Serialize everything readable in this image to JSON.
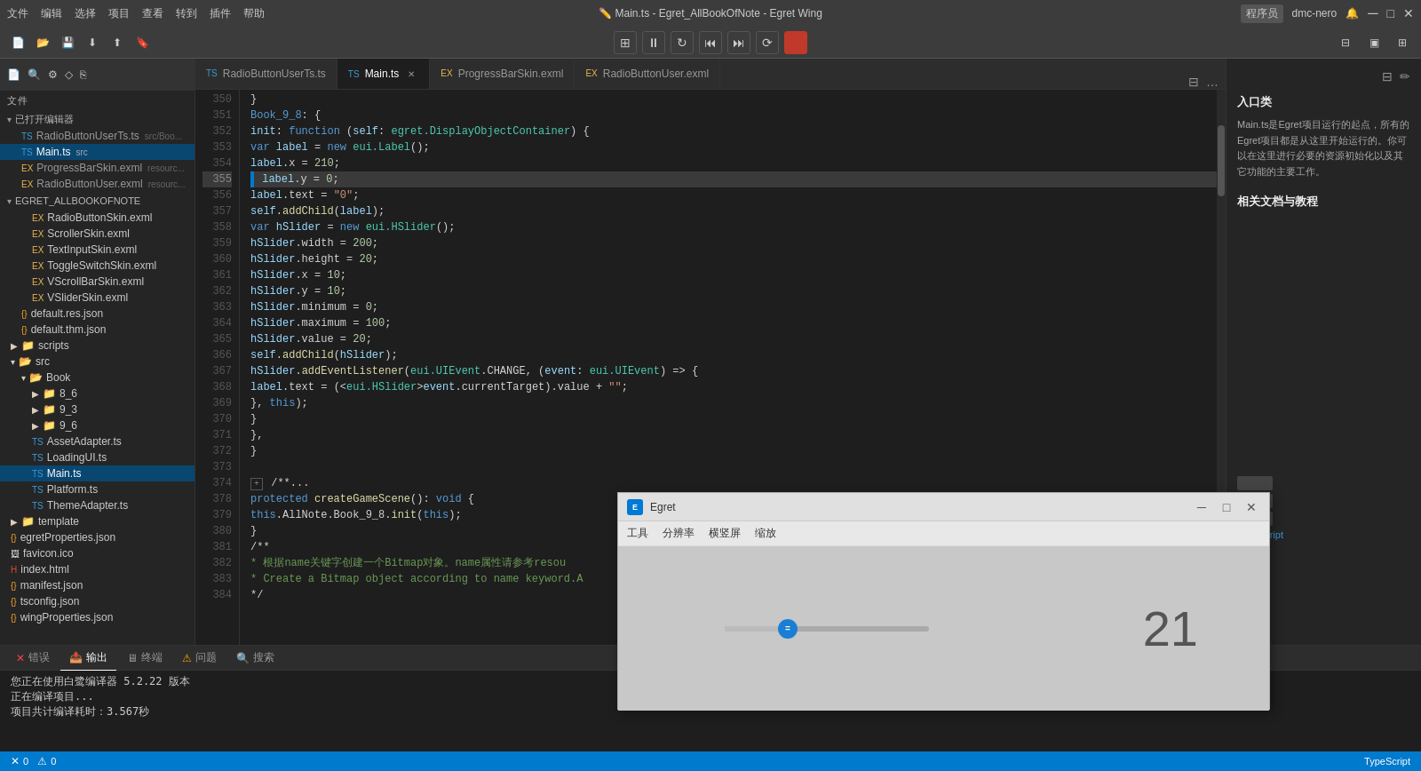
{
  "titlebar": {
    "menus": [
      "文件",
      "编辑",
      "选择",
      "项目",
      "查看",
      "转到",
      "插件",
      "帮助"
    ],
    "title": "Main.ts - Egret_AllBookOfNote - Egret Wing",
    "user": "程序员",
    "username": "dmc-nero"
  },
  "toolbar": {
    "buttons": [
      "new-file",
      "open",
      "save-all",
      "download",
      "upload",
      "bookmark"
    ]
  },
  "run_toolbar": {
    "buttons": [
      "grid",
      "pause",
      "refresh",
      "prev",
      "next",
      "reload",
      "stop"
    ]
  },
  "tabs": [
    {
      "label": "RadioButtonUserTs.ts",
      "icon": "ts",
      "active": false,
      "closable": false
    },
    {
      "label": "Main.ts",
      "icon": "ts",
      "active": true,
      "closable": true
    },
    {
      "label": "ProgressBarSkin.exml",
      "icon": "exml",
      "active": false,
      "closable": false
    },
    {
      "label": "RadioButtonUser.exml",
      "icon": "exml",
      "active": false,
      "closable": false
    }
  ],
  "sidebar": {
    "section_open_files": "已打开编辑器",
    "open_files": [
      {
        "label": "RadioButtonUserTs.ts",
        "sub": "src/Boo...",
        "icon": "ts"
      },
      {
        "label": "Main.ts",
        "sub": "src",
        "icon": "ts",
        "active": true
      },
      {
        "label": "ProgressBarSkin.exml",
        "sub": "resourc...",
        "icon": "exml"
      },
      {
        "label": "RadioButtonUser.exml",
        "sub": "resourc...",
        "icon": "exml"
      }
    ],
    "section_project": "EGRET_ALLBOOKOFNOTE",
    "tree": [
      {
        "label": "RadioButtonSkin.exml",
        "indent": 2,
        "icon": "exml"
      },
      {
        "label": "ScrollerSkin.exml",
        "indent": 2,
        "icon": "exml"
      },
      {
        "label": "TextInputSkin.exml",
        "indent": 2,
        "icon": "exml"
      },
      {
        "label": "ToggleSwitchSkin.exml",
        "indent": 2,
        "icon": "exml"
      },
      {
        "label": "VScrollBarSkin.exml",
        "indent": 2,
        "icon": "exml"
      },
      {
        "label": "VSliderSkin.exml",
        "indent": 2,
        "icon": "exml"
      },
      {
        "label": "default.res.json",
        "indent": 1,
        "icon": "json"
      },
      {
        "label": "default.thm.json",
        "indent": 1,
        "icon": "json"
      },
      {
        "label": "scripts",
        "indent": 0,
        "icon": "folder"
      },
      {
        "label": "src",
        "indent": 0,
        "icon": "folder-open"
      },
      {
        "label": "Book",
        "indent": 1,
        "icon": "folder-open"
      },
      {
        "label": "8_6",
        "indent": 2,
        "icon": "folder"
      },
      {
        "label": "9_3",
        "indent": 2,
        "icon": "folder"
      },
      {
        "label": "9_6",
        "indent": 2,
        "icon": "folder"
      },
      {
        "label": "AssetAdapter.ts",
        "indent": 2,
        "icon": "ts"
      },
      {
        "label": "LoadingUI.ts",
        "indent": 2,
        "icon": "ts"
      },
      {
        "label": "Main.ts",
        "indent": 2,
        "icon": "ts",
        "active": true
      },
      {
        "label": "Platform.ts",
        "indent": 2,
        "icon": "ts"
      },
      {
        "label": "ThemeAdapter.ts",
        "indent": 2,
        "icon": "ts"
      },
      {
        "label": "template",
        "indent": 0,
        "icon": "folder"
      },
      {
        "label": "egretProperties.json",
        "indent": 0,
        "icon": "json"
      },
      {
        "label": "favicon.ico",
        "indent": 0,
        "icon": "ico"
      },
      {
        "label": "index.html",
        "indent": 0,
        "icon": "html"
      },
      {
        "label": "manifest.json",
        "indent": 0,
        "icon": "json"
      },
      {
        "label": "tsconfig.json",
        "indent": 0,
        "icon": "json"
      },
      {
        "label": "wingProperties.json",
        "indent": 0,
        "icon": "json"
      }
    ]
  },
  "code": {
    "lines": [
      {
        "num": "350",
        "tokens": [
          {
            "t": "plain",
            "v": "    }"
          }
        ]
      },
      {
        "num": "351",
        "tokens": [
          {
            "t": "plain",
            "v": "    "
          },
          {
            "t": "kw",
            "v": "Book_9_8"
          },
          {
            "t": "plain",
            "v": ": {"
          }
        ]
      },
      {
        "num": "352",
        "tokens": [
          {
            "t": "plain",
            "v": "        "
          },
          {
            "t": "var",
            "v": "init"
          },
          {
            "t": "plain",
            "v": ": "
          },
          {
            "t": "kw",
            "v": "function"
          },
          {
            "t": "plain",
            "v": " ("
          },
          {
            "t": "var",
            "v": "self"
          },
          {
            "t": "plain",
            "v": ": "
          },
          {
            "t": "type",
            "v": "egret.DisplayObjectContainer"
          },
          {
            "t": "plain",
            "v": ") {"
          }
        ]
      },
      {
        "num": "353",
        "tokens": [
          {
            "t": "plain",
            "v": "            "
          },
          {
            "t": "kw",
            "v": "var"
          },
          {
            "t": "plain",
            "v": " "
          },
          {
            "t": "var",
            "v": "label"
          },
          {
            "t": "plain",
            "v": " = "
          },
          {
            "t": "kw",
            "v": "new"
          },
          {
            "t": "plain",
            "v": " "
          },
          {
            "t": "type",
            "v": "eui.Label"
          },
          {
            "t": "plain",
            "v": "();"
          }
        ]
      },
      {
        "num": "354",
        "tokens": [
          {
            "t": "plain",
            "v": "            "
          },
          {
            "t": "var",
            "v": "label"
          },
          {
            "t": "plain",
            "v": ".x = "
          },
          {
            "t": "num",
            "v": "210"
          },
          {
            "t": "plain",
            "v": ";"
          }
        ]
      },
      {
        "num": "355",
        "tokens": [
          {
            "t": "plain",
            "v": "            "
          },
          {
            "t": "var",
            "v": "label"
          },
          {
            "t": "plain",
            "v": ".y = "
          },
          {
            "t": "num",
            "v": "0"
          },
          {
            "t": "plain",
            "v": ";"
          }
        ],
        "highlighted": true
      },
      {
        "num": "356",
        "tokens": [
          {
            "t": "plain",
            "v": "            "
          },
          {
            "t": "var",
            "v": "label"
          },
          {
            "t": "plain",
            "v": ".text = "
          },
          {
            "t": "str",
            "v": "\"0\""
          },
          {
            "t": "plain",
            "v": ";"
          }
        ]
      },
      {
        "num": "357",
        "tokens": [
          {
            "t": "plain",
            "v": "            "
          },
          {
            "t": "var",
            "v": "self"
          },
          {
            "t": "plain",
            "v": "."
          },
          {
            "t": "fn",
            "v": "addChild"
          },
          {
            "t": "plain",
            "v": "("
          },
          {
            "t": "var",
            "v": "label"
          },
          {
            "t": "plain",
            "v": ");"
          }
        ]
      },
      {
        "num": "358",
        "tokens": [
          {
            "t": "plain",
            "v": "            "
          },
          {
            "t": "kw",
            "v": "var"
          },
          {
            "t": "plain",
            "v": " "
          },
          {
            "t": "var",
            "v": "hSlider"
          },
          {
            "t": "plain",
            "v": " = "
          },
          {
            "t": "kw",
            "v": "new"
          },
          {
            "t": "plain",
            "v": " "
          },
          {
            "t": "type",
            "v": "eui.HSlider"
          },
          {
            "t": "plain",
            "v": "();"
          }
        ]
      },
      {
        "num": "359",
        "tokens": [
          {
            "t": "plain",
            "v": "            "
          },
          {
            "t": "var",
            "v": "hSlider"
          },
          {
            "t": "plain",
            "v": ".width = "
          },
          {
            "t": "num",
            "v": "200"
          },
          {
            "t": "plain",
            "v": ";"
          }
        ]
      },
      {
        "num": "360",
        "tokens": [
          {
            "t": "plain",
            "v": "            "
          },
          {
            "t": "var",
            "v": "hSlider"
          },
          {
            "t": "plain",
            "v": ".height = "
          },
          {
            "t": "num",
            "v": "20"
          },
          {
            "t": "plain",
            "v": ";"
          }
        ]
      },
      {
        "num": "361",
        "tokens": [
          {
            "t": "plain",
            "v": "            "
          },
          {
            "t": "var",
            "v": "hSlider"
          },
          {
            "t": "plain",
            "v": ".x = "
          },
          {
            "t": "num",
            "v": "10"
          },
          {
            "t": "plain",
            "v": ";"
          }
        ]
      },
      {
        "num": "362",
        "tokens": [
          {
            "t": "plain",
            "v": "            "
          },
          {
            "t": "var",
            "v": "hSlider"
          },
          {
            "t": "plain",
            "v": ".y = "
          },
          {
            "t": "num",
            "v": "10"
          },
          {
            "t": "plain",
            "v": ";"
          }
        ]
      },
      {
        "num": "363",
        "tokens": [
          {
            "t": "plain",
            "v": "            "
          },
          {
            "t": "var",
            "v": "hSlider"
          },
          {
            "t": "plain",
            "v": ".minimum = "
          },
          {
            "t": "num",
            "v": "0"
          },
          {
            "t": "plain",
            "v": ";"
          }
        ]
      },
      {
        "num": "364",
        "tokens": [
          {
            "t": "plain",
            "v": "            "
          },
          {
            "t": "var",
            "v": "hSlider"
          },
          {
            "t": "plain",
            "v": ".maximum = "
          },
          {
            "t": "num",
            "v": "100"
          },
          {
            "t": "plain",
            "v": ";"
          }
        ]
      },
      {
        "num": "365",
        "tokens": [
          {
            "t": "plain",
            "v": "            "
          },
          {
            "t": "var",
            "v": "hSlider"
          },
          {
            "t": "plain",
            "v": ".value = "
          },
          {
            "t": "num",
            "v": "20"
          },
          {
            "t": "plain",
            "v": ";"
          }
        ]
      },
      {
        "num": "366",
        "tokens": [
          {
            "t": "plain",
            "v": "            "
          },
          {
            "t": "var",
            "v": "self"
          },
          {
            "t": "plain",
            "v": "."
          },
          {
            "t": "fn",
            "v": "addChild"
          },
          {
            "t": "plain",
            "v": "("
          },
          {
            "t": "var",
            "v": "hSlider"
          },
          {
            "t": "plain",
            "v": ");"
          }
        ]
      },
      {
        "num": "367",
        "tokens": [
          {
            "t": "plain",
            "v": "            "
          },
          {
            "t": "var",
            "v": "hSlider"
          },
          {
            "t": "plain",
            "v": "."
          },
          {
            "t": "fn",
            "v": "addEventListener"
          },
          {
            "t": "plain",
            "v": "("
          },
          {
            "t": "type",
            "v": "eui.UIEvent"
          },
          {
            "t": "plain",
            "v": ".CHANGE, ("
          },
          {
            "t": "var",
            "v": "event"
          },
          {
            "t": "plain",
            "v": ": "
          },
          {
            "t": "type",
            "v": "eui.UIEvent"
          },
          {
            "t": "plain",
            "v": ") => {"
          }
        ]
      },
      {
        "num": "368",
        "tokens": [
          {
            "t": "plain",
            "v": "                "
          },
          {
            "t": "var",
            "v": "label"
          },
          {
            "t": "plain",
            "v": ".text = (<"
          },
          {
            "t": "type",
            "v": "eui.HSlider"
          },
          {
            "t": "plain",
            "v": ">"
          },
          {
            "t": "var",
            "v": "event"
          },
          {
            "t": "plain",
            "v": ".currentTarget).value + "
          },
          {
            "t": "str",
            "v": "\"\""
          },
          {
            "t": "plain",
            "v": ";"
          }
        ]
      },
      {
        "num": "369",
        "tokens": [
          {
            "t": "plain",
            "v": "            }, "
          },
          {
            "t": "kw",
            "v": "this"
          },
          {
            "t": "plain",
            "v": ");"
          }
        ]
      },
      {
        "num": "370",
        "tokens": [
          {
            "t": "plain",
            "v": "        }"
          }
        ]
      },
      {
        "num": "371",
        "tokens": [
          {
            "t": "plain",
            "v": "    },"
          }
        ]
      },
      {
        "num": "372",
        "tokens": [
          {
            "t": "plain",
            "v": "    }"
          }
        ]
      },
      {
        "num": "373",
        "tokens": [
          {
            "t": "plain",
            "v": ""
          }
        ]
      },
      {
        "num": "374",
        "tokens": [
          {
            "t": "plain",
            "v": "    /**..."
          }
        ]
      },
      {
        "num": "378",
        "tokens": [
          {
            "t": "plain",
            "v": "    "
          },
          {
            "t": "kw",
            "v": "protected"
          },
          {
            "t": "plain",
            "v": " "
          },
          {
            "t": "fn",
            "v": "createGameScene"
          },
          {
            "t": "plain",
            "v": "(): "
          },
          {
            "t": "kw",
            "v": "void"
          },
          {
            "t": "plain",
            "v": " {"
          }
        ]
      },
      {
        "num": "379",
        "tokens": [
          {
            "t": "plain",
            "v": "        "
          },
          {
            "t": "kw",
            "v": "this"
          },
          {
            "t": "plain",
            "v": ".AllNote.Book_9_8."
          },
          {
            "t": "fn",
            "v": "init"
          },
          {
            "t": "plain",
            "v": "("
          },
          {
            "t": "kw",
            "v": "this"
          },
          {
            "t": "plain",
            "v": ");"
          }
        ]
      },
      {
        "num": "380",
        "tokens": [
          {
            "t": "plain",
            "v": "    }"
          }
        ]
      },
      {
        "num": "381",
        "tokens": [
          {
            "t": "plain",
            "v": "    /**"
          }
        ]
      },
      {
        "num": "382",
        "tokens": [
          {
            "t": "cmt",
            "v": "     * 根据name关键字创建一个Bitmap对象。name属性请参考resou"
          }
        ]
      },
      {
        "num": "383",
        "tokens": [
          {
            "t": "cmt",
            "v": "     * Create a Bitmap object according to name keyword.A"
          }
        ]
      },
      {
        "num": "384",
        "tokens": [
          {
            "t": "plain",
            "v": "     */"
          }
        ]
      }
    ]
  },
  "right_panel": {
    "title": "入口类",
    "description": "Main.ts是Egret项目运行的起点，所有的Egret项目都是从这里开始运行的。你可以在这里进行必要的资源初始化以及其它功能的主要工作。",
    "subtitle": "相关文档与教程"
  },
  "bottom_panel": {
    "tabs": [
      "错误",
      "输出",
      "终端",
      "问题",
      "搜索"
    ],
    "active_tab": "输出",
    "messages": [
      "您正在使用白鹭编译器 5.2.22 版本",
      "正在编译项目...",
      "项目共计编译耗时：3.567秒"
    ]
  },
  "statusbar": {
    "errors": "0",
    "warnings": "0",
    "language": "TypeScript"
  },
  "egret_popup": {
    "title": "Egret",
    "menus": [
      "工具",
      "分辨率",
      "横竖屏",
      "缩放"
    ],
    "slider_value": "21"
  }
}
